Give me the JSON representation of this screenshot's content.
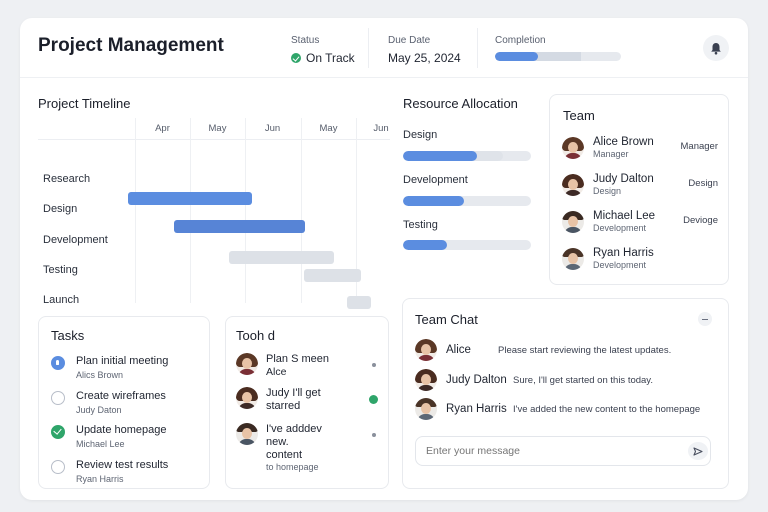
{
  "header": {
    "title": "Project Management",
    "status_label": "Status",
    "status_value": "On Track",
    "due_label": "Due Date",
    "due_value": "May 25, 2024",
    "completion_label": "Completion",
    "completion_progress": 0.34,
    "completion_secondary": 0.68
  },
  "timeline": {
    "title": "Project Timeline",
    "months": [
      "Apr",
      "May",
      "Jun",
      "May",
      "Jun"
    ],
    "rows": [
      "Research",
      "Design",
      "Development",
      "Testing",
      "Launch"
    ]
  },
  "resources": {
    "title": "Resource Allocation",
    "items": [
      {
        "label": "Design",
        "fill": 0.58,
        "track": 0.78
      },
      {
        "label": "Development",
        "fill": 0.48
      },
      {
        "label": "Testing",
        "fill": 0.34
      }
    ]
  },
  "team": {
    "title": "Team",
    "members": [
      {
        "name": "Alice Brown",
        "sub": "Manager",
        "role": "Manager"
      },
      {
        "name": "Judy Dalton",
        "sub": "Design",
        "role": "Design"
      },
      {
        "name": "Michael Lee",
        "sub": "Development",
        "role": "Devioge"
      },
      {
        "name": "Ryan Harris",
        "sub": "Development",
        "role": ""
      }
    ]
  },
  "tasks": {
    "title": "Tasks",
    "items": [
      {
        "name": "Plan initial meeting",
        "assignee": "Alics Brown"
      },
      {
        "name": "Create wireframes",
        "assignee": "Judy Daton"
      },
      {
        "name": "Update homepage",
        "assignee": "Michael Lee"
      },
      {
        "name": "Review test results",
        "assignee": "Ryan Harris"
      }
    ]
  },
  "todo": {
    "title": "Tooh d",
    "items": [
      {
        "line1": "Plan S meen",
        "line2": "Alce",
        "line3": "",
        "line4": ""
      },
      {
        "line1": "Judy I'll get",
        "line2": "starred",
        "line3": "",
        "line4": ""
      },
      {
        "line1": "I've adddev",
        "line2": "new.",
        "line3": "content",
        "line4": "to homepage"
      }
    ]
  },
  "chat": {
    "title": "Team Chat",
    "messages": [
      {
        "name": "Alice",
        "text": "Please start reviewing the latest updates."
      },
      {
        "name": "Judy Dalton",
        "text": "Sure, I'll get started on this today."
      },
      {
        "name": "Ryan Harris",
        "text": "I've added the new content to the homepage"
      }
    ],
    "input_placeholder": "Enter your message"
  },
  "colors": {
    "accent": "#5b8de0",
    "success": "#2fa56a",
    "bar_light": "#dde1e7"
  }
}
